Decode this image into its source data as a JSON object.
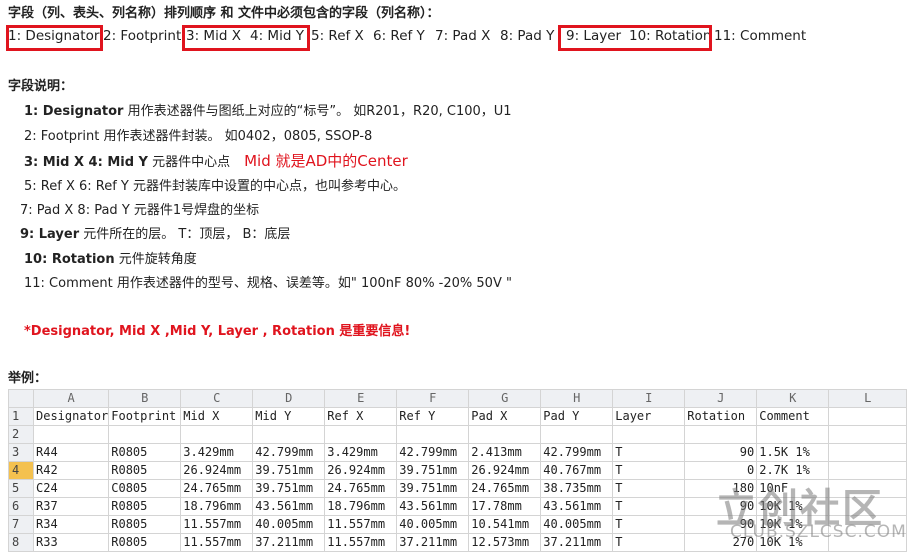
{
  "header": {
    "title": "字段（列、表头、列名称）排列顺序 和 文件中必须包含的字段（列名称）："
  },
  "fields": [
    "1: Designator",
    "2: Footprint",
    "3: Mid X",
    "4: Mid Y",
    "5: Ref X",
    "6: Ref Y",
    "7: Pad X",
    "8: Pad Y",
    "9: Layer",
    "10: Rotation",
    "11: Comment"
  ],
  "explanation": {
    "title": "字段说明：",
    "items": [
      {
        "label": "1:  Designator",
        "text": " 用作表述器件与图纸上对应的“标号”。 如R201，R20, C100，U1"
      },
      {
        "label": "",
        "text": "2:   Footprint 用作表述器件封装。 如0402，0805, SSOP-8"
      },
      {
        "label": "3: Mid X    4: Mid Y",
        "text": "    元器件中心点",
        "note": "Mid 就是AD中的Center"
      },
      {
        "label": "",
        "text": "5: Ref X   6: Ref Y     元器件封装库中设置的中心点，也叫参考中心。"
      },
      {
        "label": "",
        "text": "7: Pad X   8: Pad Y    元器件1号焊盘的坐标"
      },
      {
        "label": "9: Layer",
        "text": "  元件所在的层。   T：顶层， B：底层"
      },
      {
        "label": "10: Rotation",
        "text": "  元件旋转角度"
      },
      {
        "label": "",
        "text": "11:  Comment 用作表述器件的型号、规格、误差等。如\" 100nF  80% -20%  50V \""
      }
    ],
    "important": "*Designator, Mid X  ,Mid Y,  Layer ,   Rotation 是重要信息!"
  },
  "example": {
    "title": "举例：",
    "columns": [
      "A",
      "B",
      "C",
      "D",
      "E",
      "F",
      "G",
      "H",
      "I",
      "J",
      "K",
      "L"
    ],
    "rows": [
      {
        "n": "1",
        "cells": [
          "Designator",
          "Footprint",
          "Mid X",
          "Mid Y",
          "Ref X",
          "Ref Y",
          "Pad X",
          "Pad Y",
          "Layer",
          "Rotation",
          "Comment",
          ""
        ]
      },
      {
        "n": "2",
        "cells": [
          "",
          "",
          "",
          "",
          "",
          "",
          "",
          "",
          "",
          "",
          "",
          ""
        ]
      },
      {
        "n": "3",
        "cells": [
          "R44",
          "R0805",
          "3.429mm",
          "42.799mm",
          "3.429mm",
          "42.799mm",
          "2.413mm",
          "42.799mm",
          "T",
          "90",
          "1.5K 1%",
          ""
        ]
      },
      {
        "n": "4",
        "cells": [
          "R42",
          "R0805",
          "26.924mm",
          "39.751mm",
          "26.924mm",
          "39.751mm",
          "26.924mm",
          "40.767mm",
          "T",
          "0",
          "2.7K 1%",
          ""
        ]
      },
      {
        "n": "5",
        "cells": [
          "C24",
          "C0805",
          "24.765mm",
          "39.751mm",
          "24.765mm",
          "39.751mm",
          "24.765mm",
          "38.735mm",
          "T",
          "180",
          "10nF",
          ""
        ]
      },
      {
        "n": "6",
        "cells": [
          "R37",
          "R0805",
          "18.796mm",
          "43.561mm",
          "18.796mm",
          "43.561mm",
          "17.78mm",
          "43.561mm",
          "T",
          "90",
          "10K 1%",
          ""
        ]
      },
      {
        "n": "7",
        "cells": [
          "R34",
          "R0805",
          "11.557mm",
          "40.005mm",
          "11.557mm",
          "40.005mm",
          "10.541mm",
          "40.005mm",
          "T",
          "90",
          "10K 1%",
          ""
        ]
      },
      {
        "n": "8",
        "cells": [
          "R33",
          "R0805",
          "11.557mm",
          "37.211mm",
          "11.557mm",
          "37.211mm",
          "12.573mm",
          "37.211mm",
          "T",
          "270",
          "10K 1%",
          ""
        ]
      }
    ]
  },
  "watermark": {
    "line1": "立创社区",
    "line2": "CLUB.SZLCSC.COM"
  },
  "colors": {
    "highlight_box": "#e0141e",
    "note_red": "#e0141e",
    "header_bg": "#eef0f3",
    "selected_row": "#f4c14f"
  }
}
